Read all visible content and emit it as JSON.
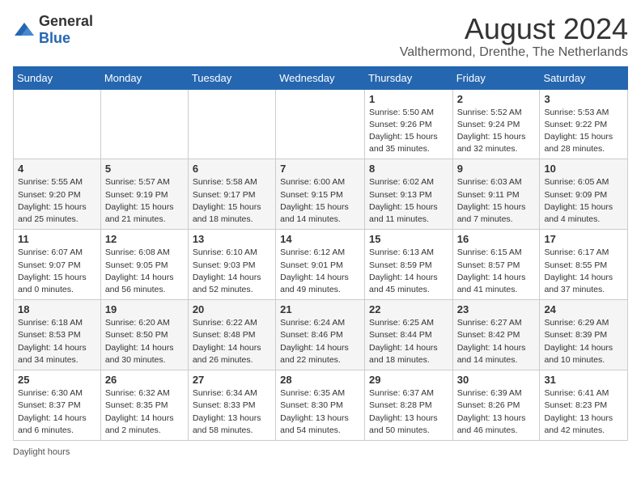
{
  "header": {
    "logo_general": "General",
    "logo_blue": "Blue",
    "main_title": "August 2024",
    "subtitle": "Valthermond, Drenthe, The Netherlands"
  },
  "days_of_week": [
    "Sunday",
    "Monday",
    "Tuesday",
    "Wednesday",
    "Thursday",
    "Friday",
    "Saturday"
  ],
  "weeks": [
    [
      {
        "day": "",
        "detail": ""
      },
      {
        "day": "",
        "detail": ""
      },
      {
        "day": "",
        "detail": ""
      },
      {
        "day": "",
        "detail": ""
      },
      {
        "day": "1",
        "detail": "Sunrise: 5:50 AM\nSunset: 9:26 PM\nDaylight: 15 hours\nand 35 minutes."
      },
      {
        "day": "2",
        "detail": "Sunrise: 5:52 AM\nSunset: 9:24 PM\nDaylight: 15 hours\nand 32 minutes."
      },
      {
        "day": "3",
        "detail": "Sunrise: 5:53 AM\nSunset: 9:22 PM\nDaylight: 15 hours\nand 28 minutes."
      }
    ],
    [
      {
        "day": "4",
        "detail": "Sunrise: 5:55 AM\nSunset: 9:20 PM\nDaylight: 15 hours\nand 25 minutes."
      },
      {
        "day": "5",
        "detail": "Sunrise: 5:57 AM\nSunset: 9:19 PM\nDaylight: 15 hours\nand 21 minutes."
      },
      {
        "day": "6",
        "detail": "Sunrise: 5:58 AM\nSunset: 9:17 PM\nDaylight: 15 hours\nand 18 minutes."
      },
      {
        "day": "7",
        "detail": "Sunrise: 6:00 AM\nSunset: 9:15 PM\nDaylight: 15 hours\nand 14 minutes."
      },
      {
        "day": "8",
        "detail": "Sunrise: 6:02 AM\nSunset: 9:13 PM\nDaylight: 15 hours\nand 11 minutes."
      },
      {
        "day": "9",
        "detail": "Sunrise: 6:03 AM\nSunset: 9:11 PM\nDaylight: 15 hours\nand 7 minutes."
      },
      {
        "day": "10",
        "detail": "Sunrise: 6:05 AM\nSunset: 9:09 PM\nDaylight: 15 hours\nand 4 minutes."
      }
    ],
    [
      {
        "day": "11",
        "detail": "Sunrise: 6:07 AM\nSunset: 9:07 PM\nDaylight: 15 hours\nand 0 minutes."
      },
      {
        "day": "12",
        "detail": "Sunrise: 6:08 AM\nSunset: 9:05 PM\nDaylight: 14 hours\nand 56 minutes."
      },
      {
        "day": "13",
        "detail": "Sunrise: 6:10 AM\nSunset: 9:03 PM\nDaylight: 14 hours\nand 52 minutes."
      },
      {
        "day": "14",
        "detail": "Sunrise: 6:12 AM\nSunset: 9:01 PM\nDaylight: 14 hours\nand 49 minutes."
      },
      {
        "day": "15",
        "detail": "Sunrise: 6:13 AM\nSunset: 8:59 PM\nDaylight: 14 hours\nand 45 minutes."
      },
      {
        "day": "16",
        "detail": "Sunrise: 6:15 AM\nSunset: 8:57 PM\nDaylight: 14 hours\nand 41 minutes."
      },
      {
        "day": "17",
        "detail": "Sunrise: 6:17 AM\nSunset: 8:55 PM\nDaylight: 14 hours\nand 37 minutes."
      }
    ],
    [
      {
        "day": "18",
        "detail": "Sunrise: 6:18 AM\nSunset: 8:53 PM\nDaylight: 14 hours\nand 34 minutes."
      },
      {
        "day": "19",
        "detail": "Sunrise: 6:20 AM\nSunset: 8:50 PM\nDaylight: 14 hours\nand 30 minutes."
      },
      {
        "day": "20",
        "detail": "Sunrise: 6:22 AM\nSunset: 8:48 PM\nDaylight: 14 hours\nand 26 minutes."
      },
      {
        "day": "21",
        "detail": "Sunrise: 6:24 AM\nSunset: 8:46 PM\nDaylight: 14 hours\nand 22 minutes."
      },
      {
        "day": "22",
        "detail": "Sunrise: 6:25 AM\nSunset: 8:44 PM\nDaylight: 14 hours\nand 18 minutes."
      },
      {
        "day": "23",
        "detail": "Sunrise: 6:27 AM\nSunset: 8:42 PM\nDaylight: 14 hours\nand 14 minutes."
      },
      {
        "day": "24",
        "detail": "Sunrise: 6:29 AM\nSunset: 8:39 PM\nDaylight: 14 hours\nand 10 minutes."
      }
    ],
    [
      {
        "day": "25",
        "detail": "Sunrise: 6:30 AM\nSunset: 8:37 PM\nDaylight: 14 hours\nand 6 minutes."
      },
      {
        "day": "26",
        "detail": "Sunrise: 6:32 AM\nSunset: 8:35 PM\nDaylight: 14 hours\nand 2 minutes."
      },
      {
        "day": "27",
        "detail": "Sunrise: 6:34 AM\nSunset: 8:33 PM\nDaylight: 13 hours\nand 58 minutes."
      },
      {
        "day": "28",
        "detail": "Sunrise: 6:35 AM\nSunset: 8:30 PM\nDaylight: 13 hours\nand 54 minutes."
      },
      {
        "day": "29",
        "detail": "Sunrise: 6:37 AM\nSunset: 8:28 PM\nDaylight: 13 hours\nand 50 minutes."
      },
      {
        "day": "30",
        "detail": "Sunrise: 6:39 AM\nSunset: 8:26 PM\nDaylight: 13 hours\nand 46 minutes."
      },
      {
        "day": "31",
        "detail": "Sunrise: 6:41 AM\nSunset: 8:23 PM\nDaylight: 13 hours\nand 42 minutes."
      }
    ]
  ],
  "footer_text": "Daylight hours"
}
